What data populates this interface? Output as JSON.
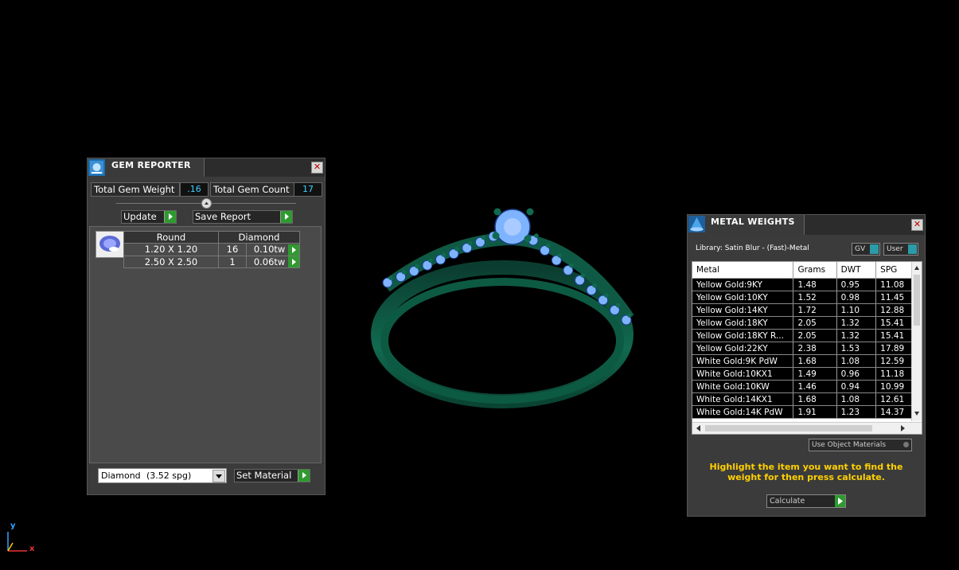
{
  "gem_reporter": {
    "title": "GEM REPORTER",
    "total_gem_weight_label": "Total Gem Weight",
    "total_gem_weight_value": ".16",
    "total_gem_count_label": "Total Gem Count",
    "total_gem_count_value": "17",
    "update_label": "Update",
    "save_report_label": "Save Report",
    "table_header": {
      "shape": "Round",
      "type": "Diamond"
    },
    "rows": [
      {
        "size": "1.20 X 1.20",
        "count": "16",
        "weight": "0.10tw"
      },
      {
        "size": "2.50 X 2.50",
        "count": "1",
        "weight": "0.06tw"
      }
    ],
    "material_select": {
      "name": "Diamond",
      "spg": "(3.52 spg)"
    },
    "set_material_label": "Set Material"
  },
  "metal_weights": {
    "title": "METAL WEIGHTS",
    "library_label": "Library: Satin Blur - (Fast)-Metal",
    "gv_label": "GV",
    "user_label": "User",
    "columns": [
      "Metal",
      "Grams",
      "DWT",
      "SPG"
    ],
    "rows": [
      {
        "metal": "Yellow Gold:9KY",
        "grams": "1.48",
        "dwt": "0.95",
        "spg": "11.08"
      },
      {
        "metal": "Yellow Gold:10KY",
        "grams": "1.52",
        "dwt": "0.98",
        "spg": "11.45"
      },
      {
        "metal": "Yellow Gold:14KY",
        "grams": "1.72",
        "dwt": "1.10",
        "spg": "12.88"
      },
      {
        "metal": "Yellow Gold:18KY",
        "grams": "2.05",
        "dwt": "1.32",
        "spg": "15.41"
      },
      {
        "metal": "Yellow Gold:18KY R...",
        "grams": "2.05",
        "dwt": "1.32",
        "spg": "15.41"
      },
      {
        "metal": "Yellow Gold:22KY",
        "grams": "2.38",
        "dwt": "1.53",
        "spg": "17.89"
      },
      {
        "metal": "White Gold:9K PdW",
        "grams": "1.68",
        "dwt": "1.08",
        "spg": "12.59"
      },
      {
        "metal": "White Gold:10KX1",
        "grams": "1.49",
        "dwt": "0.96",
        "spg": "11.18"
      },
      {
        "metal": "White Gold:10KW",
        "grams": "1.46",
        "dwt": "0.94",
        "spg": "10.99"
      },
      {
        "metal": "White Gold:14KX1",
        "grams": "1.68",
        "dwt": "1.08",
        "spg": "12.61"
      },
      {
        "metal": "White Gold:14K PdW",
        "grams": "1.91",
        "dwt": "1.23",
        "spg": "14.37"
      }
    ],
    "use_object_materials_label": "Use Object Materials",
    "instruction": "Highlight the item you want to find the weight for then press calculate.",
    "calculate_label": "Calculate"
  },
  "axis": {
    "y_label": "y",
    "x_label": "x"
  },
  "colors": {
    "ring_metal": "#0f5a45",
    "gem": "#7eb3ff",
    "accent_green": "#2f9a2f",
    "value_text": "#3fd0ff",
    "instruction_text": "#ffd000"
  }
}
